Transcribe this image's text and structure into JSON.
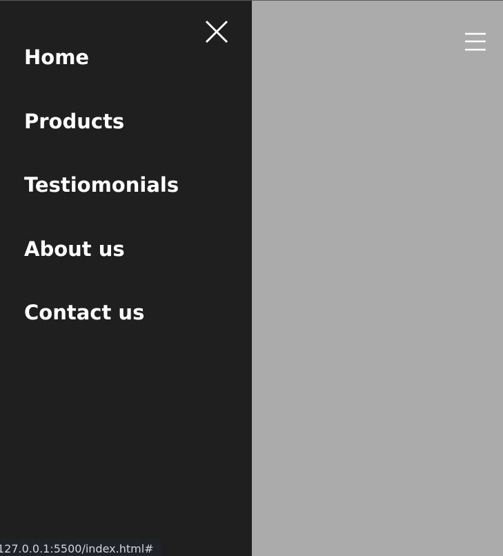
{
  "nav": {
    "items": [
      {
        "label": "Home"
      },
      {
        "label": "Products"
      },
      {
        "label": "Testiomonials"
      },
      {
        "label": "About us"
      },
      {
        "label": "Contact us"
      }
    ]
  },
  "icons": {
    "close": "close-icon",
    "menu": "hamburger-menu-icon"
  },
  "status_bar": {
    "url": "127.0.0.1:5500/index.html#"
  },
  "colors": {
    "sidebar_background": "#1f1f1f",
    "page_background": "#ababab",
    "text": "#ffffff",
    "status_background": "#202229"
  }
}
